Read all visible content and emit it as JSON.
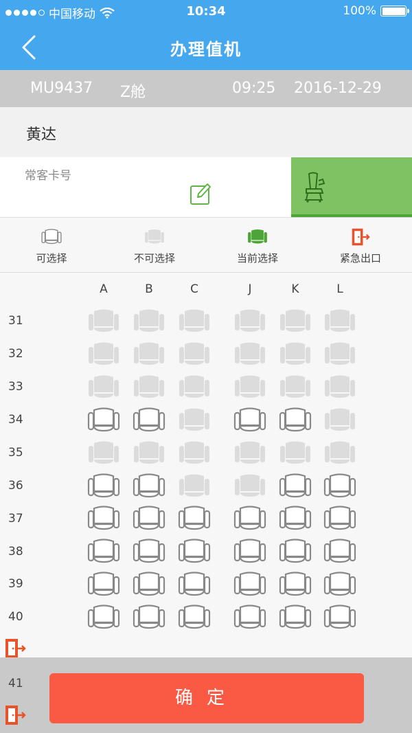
{
  "status_bar": {
    "carrier": "中国移动",
    "time": "10:34",
    "battery": "100%",
    "signal_bars_filled": 4,
    "signal_bars_total": 5
  },
  "nav": {
    "title": "办理值机",
    "back_icon": "chevron-left-icon"
  },
  "flight": {
    "number": "MU9437",
    "cabin": "Z舱",
    "time": "09:25",
    "date": "2016-12-29"
  },
  "passenger": {
    "name": "黄达"
  },
  "card": {
    "label": "常客卡号",
    "value": "",
    "edit_icon": "edit-icon",
    "seat_tab_icon": "seat-icon"
  },
  "legend": [
    {
      "label": "可选择",
      "icon": "available-seat-icon"
    },
    {
      "label": "不可选择",
      "icon": "unavailable-seat-icon"
    },
    {
      "label": "当前选择",
      "icon": "selected-seat-icon"
    },
    {
      "label": "紧急出口",
      "icon": "emergency-exit-icon"
    }
  ],
  "columns": [
    "A",
    "B",
    "C",
    "J",
    "K",
    "L"
  ],
  "rows": [
    {
      "number": "31",
      "seats": [
        "unavailable",
        "unavailable",
        "unavailable",
        "unavailable",
        "unavailable",
        "unavailable"
      ]
    },
    {
      "number": "32",
      "seats": [
        "unavailable",
        "unavailable",
        "unavailable",
        "unavailable",
        "unavailable",
        "unavailable"
      ]
    },
    {
      "number": "33",
      "seats": [
        "unavailable",
        "unavailable",
        "unavailable",
        "unavailable",
        "unavailable",
        "unavailable"
      ]
    },
    {
      "number": "34",
      "seats": [
        "available",
        "available",
        "unavailable",
        "available",
        "available",
        "unavailable"
      ]
    },
    {
      "number": "35",
      "seats": [
        "unavailable",
        "unavailable",
        "unavailable",
        "unavailable",
        "unavailable",
        "unavailable"
      ]
    },
    {
      "number": "36",
      "seats": [
        "available",
        "available",
        "unavailable",
        "unavailable",
        "available",
        "available"
      ]
    },
    {
      "number": "37",
      "seats": [
        "available",
        "available",
        "available",
        "available",
        "available",
        "available"
      ]
    },
    {
      "number": "38",
      "seats": [
        "available",
        "available",
        "available",
        "available",
        "available",
        "available"
      ]
    },
    {
      "number": "39",
      "seats": [
        "available",
        "available",
        "available",
        "available",
        "available",
        "available"
      ]
    },
    {
      "number": "40",
      "seats": [
        "available",
        "available",
        "available",
        "available",
        "available",
        "available"
      ]
    },
    {
      "number": "41",
      "seats": []
    }
  ],
  "confirm_label": "确定",
  "colors": {
    "header": "#45a7ee",
    "flight_bar": "#c9c9c9",
    "selected_green": "#4ca536",
    "seat_tab": "#7fc264",
    "exit_orange": "#e8532b",
    "confirm": "#fa5a43",
    "available_outline": "#888888",
    "unavailable_fill": "#dcdcdc"
  }
}
